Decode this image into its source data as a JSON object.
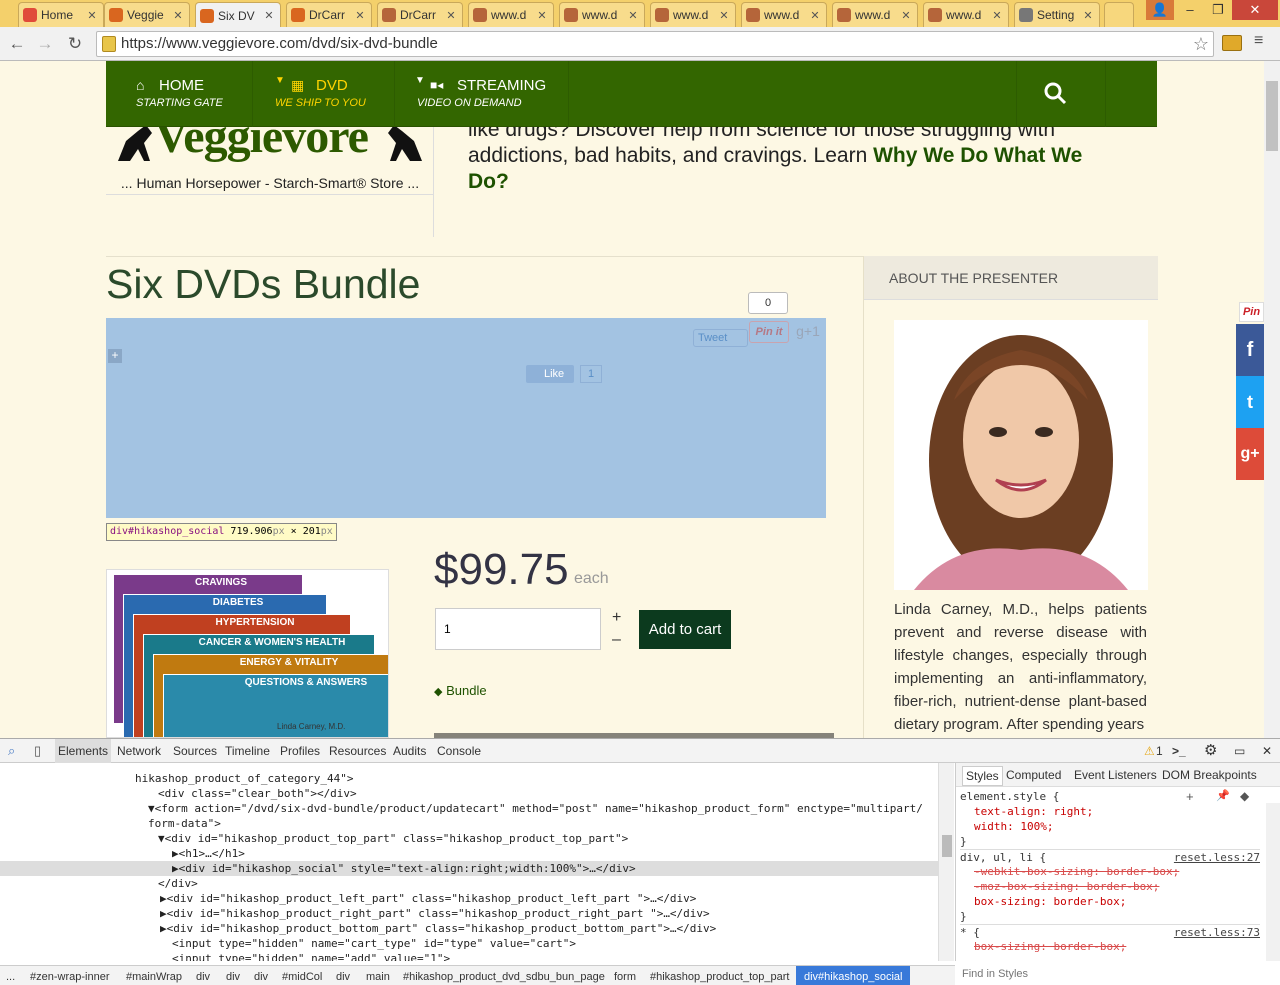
{
  "tabs": [
    {
      "label": "Home",
      "color": "#e04b3a"
    },
    {
      "label": "Veggie",
      "color": "#d9661f"
    },
    {
      "label": "Six DV",
      "color": "#d9661f"
    },
    {
      "label": "DrCarr",
      "color": "#d9661f"
    },
    {
      "label": "DrCarr",
      "color": "#b5653a"
    },
    {
      "label": "www.d",
      "color": "#b5653a"
    },
    {
      "label": "www.d",
      "color": "#b5653a"
    },
    {
      "label": "www.d",
      "color": "#b5653a"
    },
    {
      "label": "www.d",
      "color": "#b5653a"
    },
    {
      "label": "www.d",
      "color": "#b5653a"
    },
    {
      "label": "www.d",
      "color": "#b5653a"
    },
    {
      "label": "Setting",
      "color": "#777"
    }
  ],
  "tab_close": "✕",
  "url": "https://www.veggievore.com/dvd/six-dvd-bundle",
  "nav": {
    "items": [
      {
        "icon": "home-icon",
        "title": "HOME",
        "sub": "STARTING GATE"
      },
      {
        "icon": "film-icon",
        "title": "DVD",
        "sub": "WE SHIP TO YOU"
      },
      {
        "icon": "video-icon",
        "title": "STREAMING",
        "sub": "VIDEO ON DEMAND"
      }
    ]
  },
  "header": {
    "logo_text": "Veggievore",
    "tagline": "... Human Horsepower - Starch-Smart® Store ...",
    "intro_prefix": "like drugs? Discover help from science for those struggling with addictions, bad habits, and cravings. Learn ",
    "intro_link": "Why We Do What We Do?"
  },
  "product": {
    "title": "Six DVDs Bundle",
    "gplus_count": "0",
    "tweet": "Tweet",
    "pinit": "Pin it",
    "gplus": "g+1",
    "like": "Like",
    "like_count": "1",
    "tooltip_selector": "div#hikashop_social",
    "tooltip_w": "719.906",
    "tooltip_h": "201",
    "tooltip_unit": "px",
    "tooltip_x": "×",
    "price": "$99.75",
    "each": "each",
    "qty": "1",
    "add_to_cart": "Add to cart",
    "tag": "Bundle",
    "cover_titles": [
      "CRAVINGS",
      "DIABETES",
      "HYPERTENSION",
      "CANCER & WOMEN'S HEALTH",
      "ENERGY & VITALITY",
      "QUESTIONS & ANSWERS"
    ],
    "cover_bottom": "Linda Carney, M.D."
  },
  "sidebar": {
    "heading": "ABOUT THE PRESENTER",
    "bio": "Linda Carney, M.D., helps patients prevent and reverse disease with lifestyle changes, especially through implementing an anti-inflammatory, fiber-rich, nutrient-dense plant-based dietary program. After spending years"
  },
  "share": {
    "pin": "Pin",
    "facebook": "f",
    "twitter": "t",
    "google": "g+"
  },
  "devtools": {
    "tabs": [
      "Elements",
      "Network",
      "Sources",
      "Timeline",
      "Profiles",
      "Resources",
      "Audits",
      "Console"
    ],
    "warn_count": "1",
    "side_tabs": [
      "Styles",
      "Computed",
      "Event Listeners",
      "DOM Breakpoints"
    ],
    "dom_lines": [
      "hikashop_product_of_category_44\">",
      "<div class=\"clear_both\"></div>",
      "▼<form action=\"/dvd/six-dvd-bundle/product/updatecart\" method=\"post\" name=\"hikashop_product_form\" enctype=\"multipart/",
      "form-data\">",
      "▼<div id=\"hikashop_product_top_part\" class=\"hikashop_product_top_part\">",
      "▶<h1>…</h1>",
      "▶<div id=\"hikashop_social\" style=\"text-align:right;width:100%\">…</div>",
      "</div>",
      "▶<div id=\"hikashop_product_left_part\" class=\"hikashop_product_left_part \">…</div>",
      "▶<div id=\"hikashop_product_right_part\" class=\"hikashop_product_right_part \">…</div>",
      "▶<div id=\"hikashop_product_bottom_part\" class=\"hikashop_product_bottom_part\">…</div>",
      "<input type=\"hidden\" name=\"cart_type\" id=\"type\" value=\"cart\">",
      "<input type=\"hidden\" name=\"add\" value=\"1\">"
    ],
    "styles": [
      {
        "sel": "element.style {",
        "src": ""
      },
      {
        "prop": "text-align: right;",
        "strike": false
      },
      {
        "prop": "width: 100%;",
        "strike": false
      },
      {
        "sel": "}",
        "src": ""
      },
      {
        "sel": "div, ul, li {",
        "src": "reset.less:27"
      },
      {
        "prop": "-webkit-box-sizing: border-box;",
        "strike": true
      },
      {
        "prop": "-moz-box-sizing: border-box;",
        "strike": true
      },
      {
        "prop": "box-sizing: border-box;",
        "strike": false
      },
      {
        "sel": "}",
        "src": ""
      },
      {
        "sel": "* {",
        "src": "reset.less:73"
      },
      {
        "prop": "box-sizing: border-box;",
        "strike": true
      }
    ],
    "find_placeholder": "Find in Styles",
    "breadcrumbs": [
      "...",
      "#zen-wrap-inner",
      "#mainWrap",
      "div",
      "div",
      "div",
      "#midCol",
      "div",
      "main",
      "#hikashop_product_dvd_sdbu_bun_page",
      "form",
      "#hikashop_product_top_part",
      "div#hikashop_social"
    ]
  }
}
